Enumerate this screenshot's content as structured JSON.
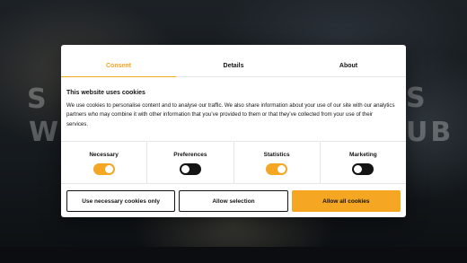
{
  "background": {
    "heading_left_1": "S",
    "heading_left_2": "W",
    "heading_right_1": "S",
    "heading_right_2": "UB"
  },
  "dialog": {
    "tabs": [
      {
        "label": "Consent",
        "active": true
      },
      {
        "label": "Details",
        "active": false
      },
      {
        "label": "About",
        "active": false
      }
    ],
    "title": "This website uses cookies",
    "description": "We use cookies to personalise content and to analyse our traffic. We also share information about your use of our site with our analytics partners who may combine it with other information that you’ve provided to them or that they’ve collected from your use of their services.",
    "consents": [
      {
        "label": "Necessary",
        "enabled": true
      },
      {
        "label": "Preferences",
        "enabled": false
      },
      {
        "label": "Statistics",
        "enabled": true
      },
      {
        "label": "Marketing",
        "enabled": false
      }
    ],
    "buttons": {
      "necessary_only": "Use necessary cookies only",
      "allow_selection": "Allow selection",
      "allow_all": "Allow all cookies"
    }
  },
  "colors": {
    "accent": "#f5a623",
    "text": "#141414",
    "toggle_off": "#141414"
  }
}
